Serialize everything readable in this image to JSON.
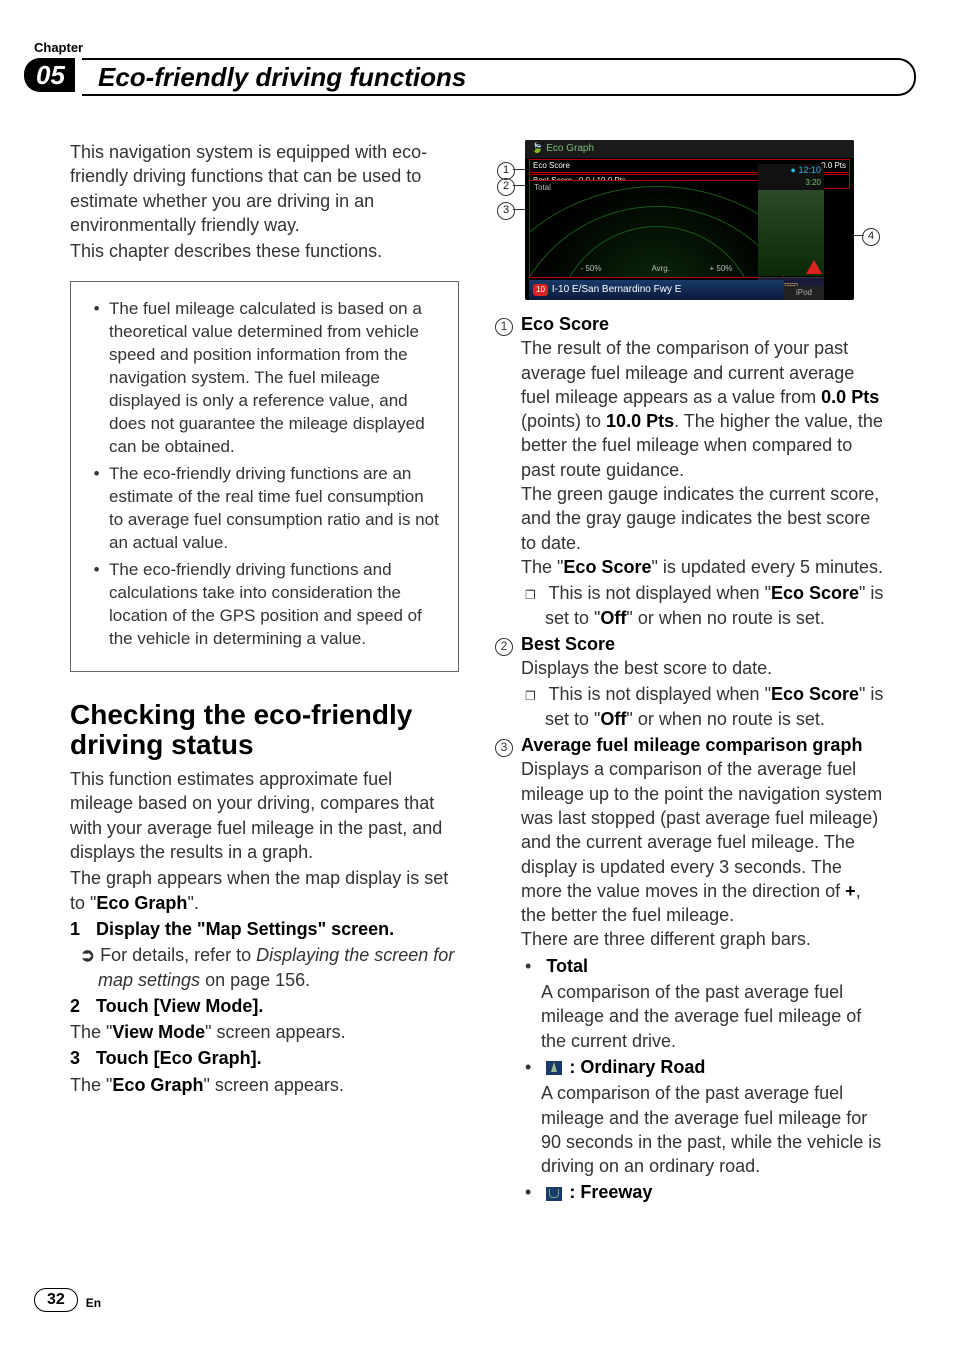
{
  "header": {
    "chapter_label": "Chapter",
    "chapter_number": "05",
    "chapter_title": "Eco-friendly driving functions"
  },
  "left": {
    "intro_p1": "This navigation system is equipped with eco-friendly driving functions that can be used to estimate whether you are driving in an environmentally friendly way.",
    "intro_p2": "This chapter describes these functions.",
    "notes": [
      "The fuel mileage calculated is based on a theoretical value determined from vehicle speed and position information from the navigation system. The fuel mileage displayed is only a reference value, and does not guarantee the mileage displayed can be obtained.",
      "The eco-friendly driving functions are an estimate of the real time fuel consumption to average fuel consumption ratio and is not an actual value.",
      "The eco-friendly driving functions and calculations take into consideration the location of the GPS position and speed of the vehicle in determining a value."
    ],
    "section_title": "Checking the eco-friendly driving status",
    "section_p1": "This function estimates approximate fuel mileage based on your driving, compares that with your average fuel mileage in the past, and displays the results in a graph.",
    "section_p2_pre": "The graph appears when the map display is set to \"",
    "section_p2_bold": "Eco Graph",
    "section_p2_post": "\".",
    "step1_num": "1",
    "step1_text": "Display the \"Map Settings\" screen.",
    "step1_ref_pre": "For details, refer to ",
    "step1_ref_italic": "Displaying the screen for map settings",
    "step1_ref_post": " on page 156.",
    "step2_num": "2",
    "step2_text": "Touch [View Mode].",
    "step2_result_pre": "The \"",
    "step2_result_bold": "View Mode",
    "step2_result_post": "\" screen appears.",
    "step3_num": "3",
    "step3_text": "Touch [Eco Graph].",
    "step3_result_pre": "The \"",
    "step3_result_bold": "Eco Graph",
    "step3_result_post": "\" screen appears."
  },
  "screenshot": {
    "title": "Eco Graph",
    "eco_score_label": "Eco Score",
    "eco_score_value": "0.0 Pts",
    "best_score_label": "Best Score",
    "best_score_value": "0.0 / 10.0 Pts",
    "total_label": "Total",
    "axis_minus": "- 50%",
    "axis_center": "Avrg.",
    "axis_plus": "+ 50%",
    "clock": "12:10",
    "sub_clock": "3:20",
    "road_shield": "10",
    "road_name": "I-10 E/San Bernardino Fwy E",
    "ipod": "iPod"
  },
  "callouts": {
    "c1": "1",
    "c2": "2",
    "c3": "3",
    "c4": "4"
  },
  "right": {
    "i1_title": "Eco Score",
    "i1_p1_pre": "The result of the comparison of your past average fuel mileage and current average fuel mileage appears as a value from ",
    "i1_p1_b1": "0.0 Pts",
    "i1_p1_mid": " (points) to ",
    "i1_p1_b2": "10.0 Pts",
    "i1_p1_post": ". The higher the value, the better the fuel mileage when compared to past route guidance.",
    "i1_p2": "The green gauge indicates the current score, and the gray gauge indicates the best score to date.",
    "i1_p3_pre": "The \"",
    "i1_p3_bold": "Eco Score",
    "i1_p3_post": "\" is updated every 5 minutes.",
    "i1_note_pre": "This is not displayed when \"",
    "i1_note_b1": "Eco Score",
    "i1_note_mid": "\" is set to \"",
    "i1_note_b2": "Off",
    "i1_note_post": "\" or when no route is set.",
    "i2_title": "Best Score",
    "i2_p1": "Displays the best score to date.",
    "i2_note_pre": "This is not displayed when \"",
    "i2_note_b1": "Eco Score",
    "i2_note_mid": "\" is set to \"",
    "i2_note_b2": "Off",
    "i2_note_post": "\" or when no route is set.",
    "i3_title": "Average fuel mileage comparison graph",
    "i3_p1_pre": "Displays a comparison of the average fuel mileage up to the point the navigation system was last stopped (past average fuel mileage) and the current average fuel mileage. The display is updated every 3 seconds. The more the value moves in the direction of ",
    "i3_p1_bold": "+",
    "i3_p1_post": ", the better the fuel mileage.",
    "i3_p2": "There are three different graph bars.",
    "i3_b1_title": "Total",
    "i3_b1_body": "A comparison of the past average fuel mileage and the average fuel mileage of the current drive.",
    "i3_b2_title": ": Ordinary Road",
    "i3_b2_body": "A comparison of the past average fuel mileage and the average fuel mileage for 90 seconds in the past, while the vehicle is driving on an ordinary road.",
    "i3_b3_title": ": Freeway"
  },
  "footer": {
    "page_number": "32",
    "lang": "En"
  }
}
